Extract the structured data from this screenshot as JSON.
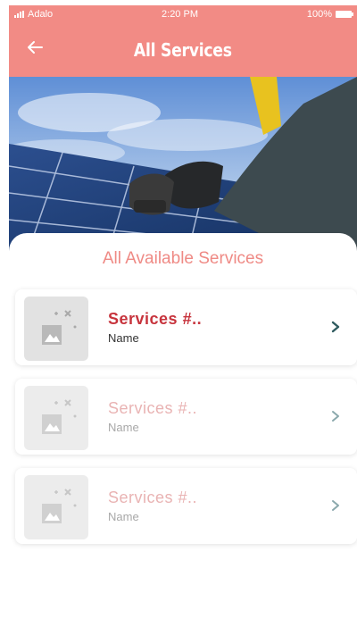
{
  "status_bar": {
    "carrier": "Adalo",
    "time": "2:20 PM",
    "battery": "100%"
  },
  "header": {
    "title": "All Services",
    "back_icon": "arrow-left-icon"
  },
  "hero": {
    "image_description_icon": "solar-panel-photo"
  },
  "section": {
    "title": "All Available Services"
  },
  "services": [
    {
      "title": "Services #..",
      "subtitle": "Name",
      "icon": "image-placeholder-icon"
    },
    {
      "title": "Services #..",
      "subtitle": "Name",
      "icon": "image-placeholder-icon"
    },
    {
      "title": "Services #..",
      "subtitle": "Name",
      "icon": "image-placeholder-icon"
    }
  ],
  "colors": {
    "accent": "#f28b85",
    "title_red": "#c7343d",
    "chevron": "#2f5b5f"
  }
}
